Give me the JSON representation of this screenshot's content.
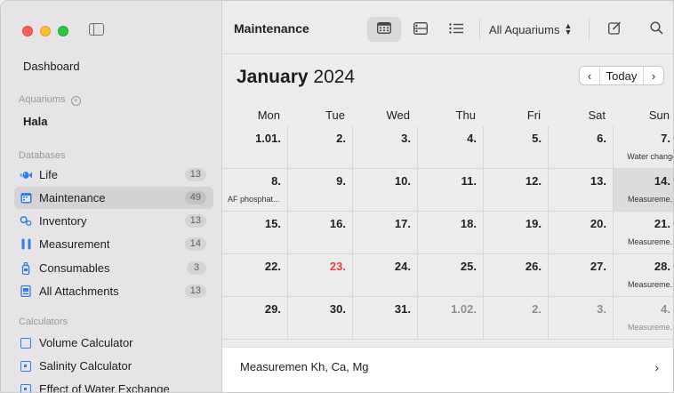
{
  "sidebar": {
    "dashboard": "Dashboard",
    "aquariums_section": "Aquariums",
    "aquarium_name": "Hala",
    "databases_section": "Databases",
    "databases": [
      {
        "label": "Life",
        "count": "13",
        "icon": "fish-icon"
      },
      {
        "label": "Maintenance",
        "count": "49",
        "icon": "calendar-icon"
      },
      {
        "label": "Inventory",
        "count": "13",
        "icon": "gears-icon"
      },
      {
        "label": "Measurement",
        "count": "14",
        "icon": "test-tubes-icon"
      },
      {
        "label": "Consumables",
        "count": "3",
        "icon": "bottle-icon"
      },
      {
        "label": "All Attachments",
        "count": "13",
        "icon": "attachment-icon"
      }
    ],
    "calculators_section": "Calculators",
    "calculators": [
      {
        "label": "Volume Calculator",
        "icon": "square-icon"
      },
      {
        "label": "Salinity Calculator",
        "icon": "square-dot-icon"
      },
      {
        "label": "Effect of Water Exchange",
        "icon": "square-dot-icon"
      }
    ]
  },
  "toolbar": {
    "title": "Maintenance",
    "aquarium_picker": "All Aquariums"
  },
  "calendar": {
    "month": "January",
    "year": "2024",
    "today_label": "Today",
    "weekdays": [
      "Mon",
      "Tue",
      "Wed",
      "Thu",
      "Fri",
      "Sat",
      "Sun"
    ],
    "weeks": [
      [
        {
          "d": "1.01."
        },
        {
          "d": "2."
        },
        {
          "d": "3."
        },
        {
          "d": "4."
        },
        {
          "d": "5."
        },
        {
          "d": "6."
        },
        {
          "d": "7.",
          "ev": "Water change"
        }
      ],
      [
        {
          "d": "8.",
          "ev": "AF phosphat..."
        },
        {
          "d": "9."
        },
        {
          "d": "10."
        },
        {
          "d": "11."
        },
        {
          "d": "12."
        },
        {
          "d": "13."
        },
        {
          "d": "14.",
          "ev": "Measureme..."
        }
      ],
      [
        {
          "d": "15."
        },
        {
          "d": "16."
        },
        {
          "d": "17."
        },
        {
          "d": "18."
        },
        {
          "d": "19."
        },
        {
          "d": "20."
        },
        {
          "d": "21.",
          "ev": "Measureme..."
        }
      ],
      [
        {
          "d": "22."
        },
        {
          "d": "23."
        },
        {
          "d": "24."
        },
        {
          "d": "25."
        },
        {
          "d": "26."
        },
        {
          "d": "27."
        },
        {
          "d": "28.",
          "ev": "Measureme..."
        }
      ],
      [
        {
          "d": "29."
        },
        {
          "d": "30."
        },
        {
          "d": "31."
        },
        {
          "d": "1.02."
        },
        {
          "d": "2."
        },
        {
          "d": "3."
        },
        {
          "d": "4.",
          "ev": "Measureme..."
        }
      ]
    ],
    "today_cell": "23.",
    "colors": {
      "today": "#e0463b",
      "accent": "#2a7fe8"
    }
  },
  "footer": {
    "text": "Measuremen Kh, Ca, Mg"
  }
}
